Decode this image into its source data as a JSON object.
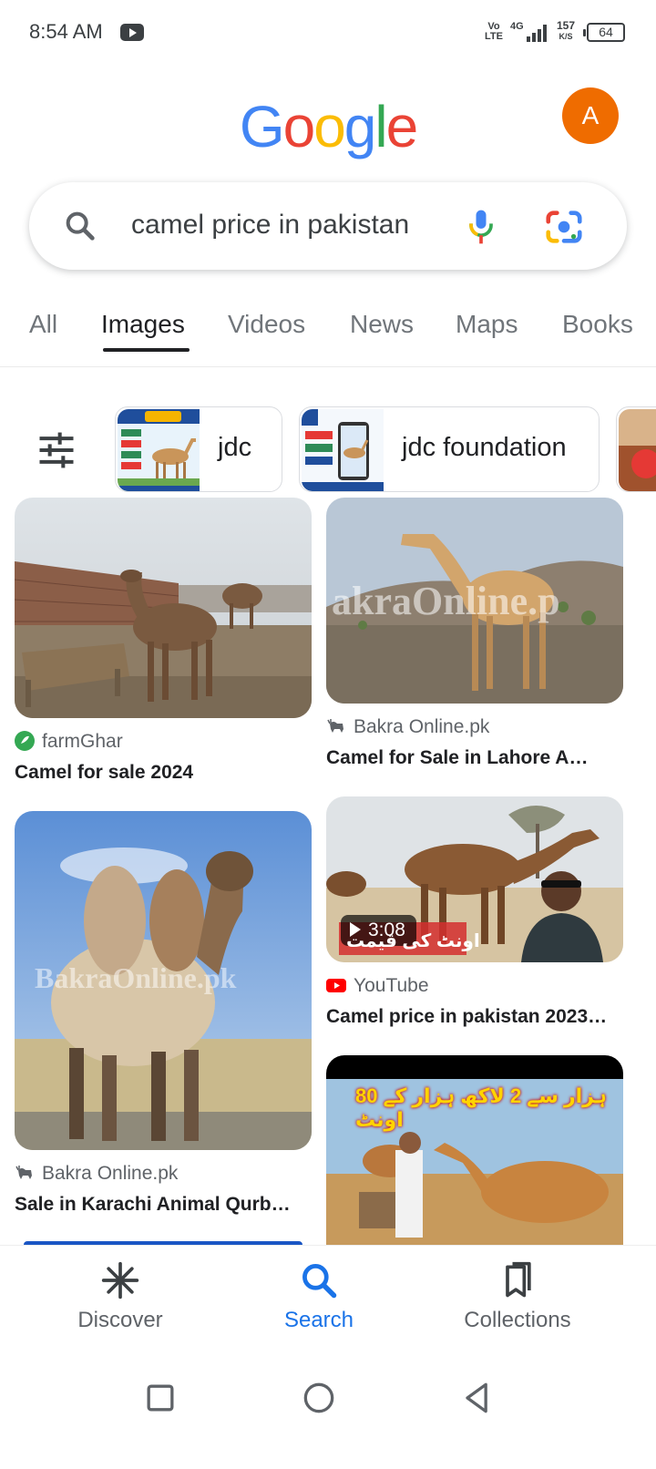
{
  "status_bar": {
    "time": "8:54 AM",
    "network_volte": "Vo LTE",
    "network_type": "4G",
    "speed_value": "157",
    "speed_unit": "K/S",
    "battery": "64"
  },
  "header": {
    "logo_letters": [
      "G",
      "o",
      "o",
      "g",
      "l",
      "e"
    ],
    "logo_colors": [
      "#4285F4",
      "#EA4335",
      "#FBBC05",
      "#4285F4",
      "#34A853",
      "#EA4335"
    ],
    "avatar_letter": "A",
    "avatar_color": "#EF6C00"
  },
  "search": {
    "query": "camel price in pakistan",
    "icons": [
      "search-icon",
      "mic-icon",
      "google-lens-icon"
    ]
  },
  "tabs": [
    {
      "label": "All",
      "active": false
    },
    {
      "label": "Images",
      "active": true
    },
    {
      "label": "Videos",
      "active": false
    },
    {
      "label": "News",
      "active": false
    },
    {
      "label": "Maps",
      "active": false
    },
    {
      "label": "Books",
      "active": false
    }
  ],
  "chips": [
    {
      "label": "jdc"
    },
    {
      "label": "jdc foundation"
    }
  ],
  "results": [
    {
      "source": "farmGhar",
      "title": "Camel for sale 2024",
      "source_icon": "farmghar-icon"
    },
    {
      "source": "Bakra Online.pk",
      "title": "Camel for Sale in Lahore Ani...",
      "source_icon": "goat-icon",
      "watermark": "akraOnline.p"
    },
    {
      "source": "Bakra Online.pk",
      "title": "Sale in Karachi Animal Qurba...",
      "source_icon": "goat-icon",
      "watermark": "BakraOnline.pk"
    },
    {
      "source": "YouTube",
      "title": "Camel price in pakistan 2023 ...",
      "source_icon": "youtube-icon",
      "duration": "3:08",
      "overlay_text": "اونٹ کی قیمت"
    },
    {
      "overlay_text": "80 ہزار سے 2 لاکھ ہزار کے اونٹ"
    }
  ],
  "bottom_nav": [
    {
      "label": "Discover",
      "icon": "discover-icon",
      "active": false
    },
    {
      "label": "Search",
      "icon": "search-icon",
      "active": true
    },
    {
      "label": "Collections",
      "icon": "collections-icon",
      "active": false
    }
  ],
  "colors": {
    "accent": "#1A73E8",
    "youtube_red": "#FF0000",
    "farmghar_green": "#34A853"
  }
}
